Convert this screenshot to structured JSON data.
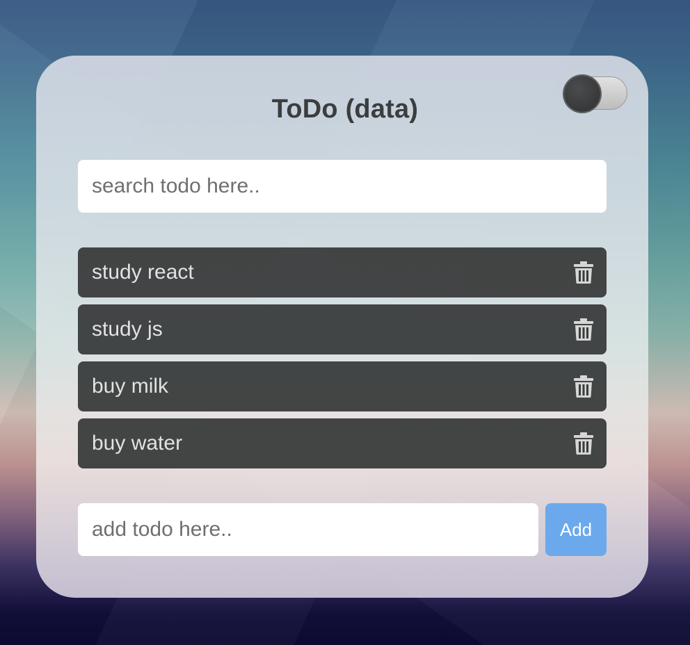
{
  "app": {
    "title": "ToDo (data)"
  },
  "theme_toggle": {
    "state": "dark"
  },
  "search": {
    "placeholder": "search todo here..",
    "value": ""
  },
  "todos": [
    {
      "text": "study react",
      "delete_icon": "trash-icon"
    },
    {
      "text": "study js",
      "delete_icon": "trash-icon"
    },
    {
      "text": "buy milk",
      "delete_icon": "trash-icon"
    },
    {
      "text": "buy water",
      "delete_icon": "trash-icon"
    }
  ],
  "add_form": {
    "placeholder": "add todo here..",
    "value": "",
    "button_label": "Add"
  },
  "colors": {
    "item_bg": "#3a3c3c",
    "item_text": "#e2e2e2",
    "add_button": "#6ba9ec",
    "title_text": "#3b3d3e"
  }
}
